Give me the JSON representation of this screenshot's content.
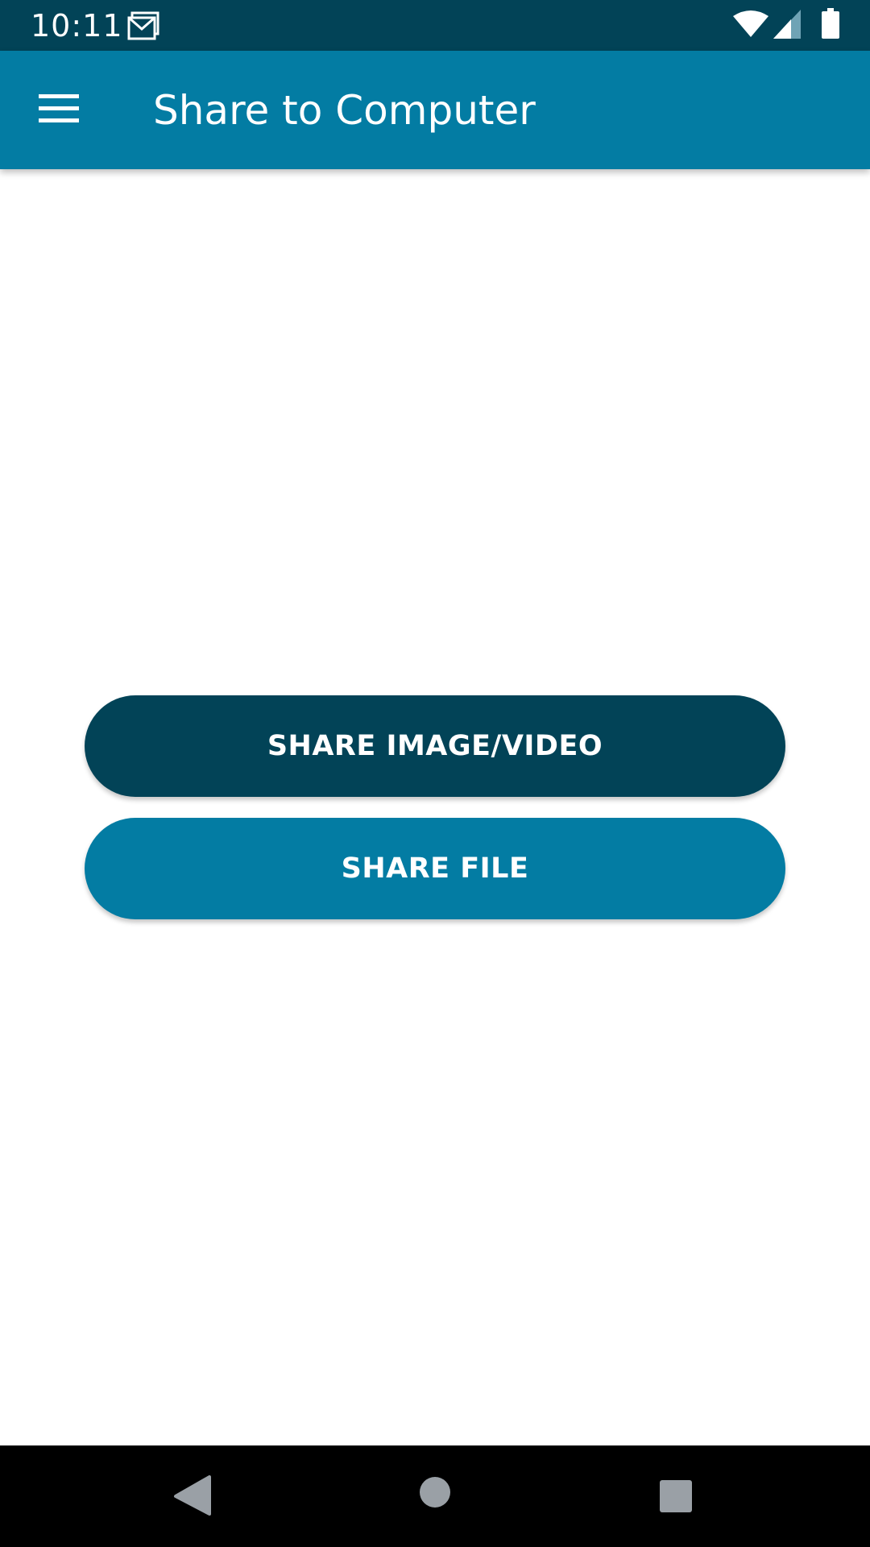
{
  "status_bar": {
    "time": "10:11",
    "left_icons": [
      "gmail-icon"
    ],
    "right_icons": [
      "wifi-icon",
      "cell-signal-icon",
      "battery-icon"
    ]
  },
  "app_bar": {
    "title": "Share to Computer",
    "nav_icon": "hamburger-menu-icon"
  },
  "actions": {
    "share_media_label": "SHARE IMAGE/VIDEO",
    "share_file_label": "SHARE FILE"
  },
  "nav_bar": {
    "icons": [
      "back-icon",
      "home-icon",
      "recents-icon"
    ]
  },
  "colors": {
    "status_bar": "#024357",
    "app_bar": "#037ca3",
    "primary_button": "#024357",
    "secondary_button": "#037ca3",
    "nav_bar": "#000000",
    "nav_icon": "#9aa0a6"
  }
}
